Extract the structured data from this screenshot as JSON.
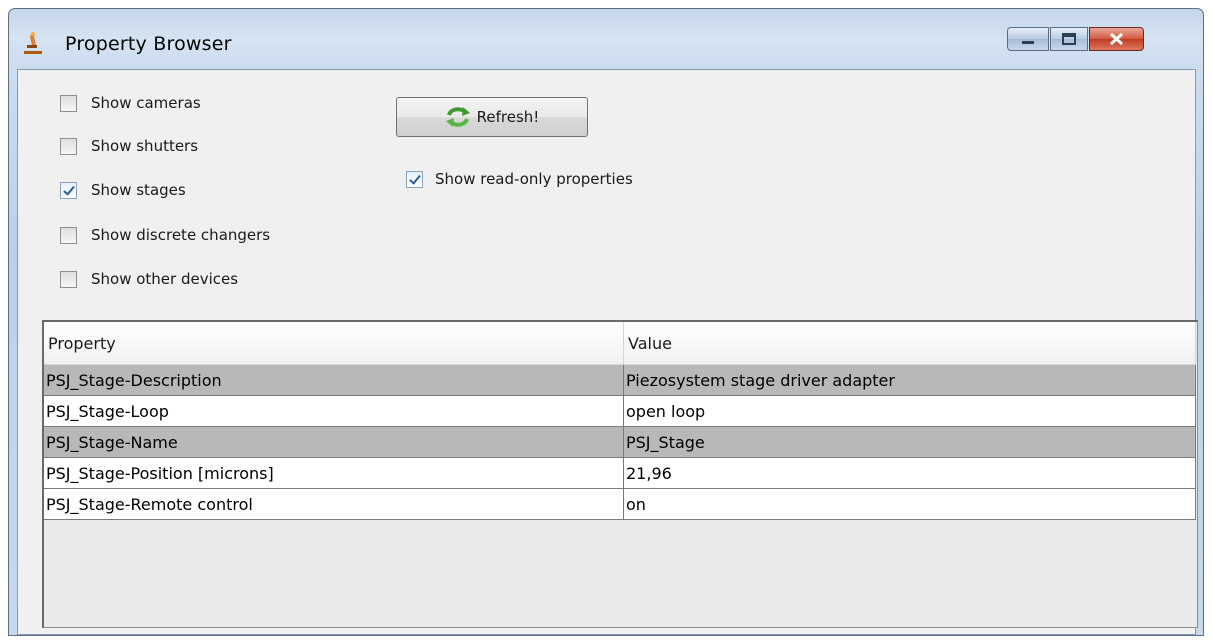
{
  "window": {
    "title": "Property Browser"
  },
  "filters": {
    "items": [
      {
        "label": "Show cameras",
        "checked": false
      },
      {
        "label": "Show shutters",
        "checked": false
      },
      {
        "label": "Show stages",
        "checked": true
      },
      {
        "label": "Show discrete changers",
        "checked": false
      },
      {
        "label": "Show other devices",
        "checked": false
      }
    ],
    "show_readonly": {
      "label": "Show read-only properties",
      "checked": true
    }
  },
  "toolbar": {
    "refresh_label": "Refresh!",
    "refresh_icon": "refresh-arrows-icon"
  },
  "table": {
    "columns": [
      "Property",
      "Value"
    ],
    "rows": [
      {
        "property": "PSJ_Stage-Description",
        "value": "Piezosystem stage driver adapter",
        "readonly": true
      },
      {
        "property": "PSJ_Stage-Loop",
        "value": "open loop",
        "readonly": false
      },
      {
        "property": "PSJ_Stage-Name",
        "value": "PSJ_Stage",
        "readonly": true
      },
      {
        "property": "PSJ_Stage-Position [microns]",
        "value": "21,96",
        "readonly": false
      },
      {
        "property": "PSJ_Stage-Remote control",
        "value": "on",
        "readonly": false
      }
    ]
  },
  "colors": {
    "readonly_row": "#b8b8b8",
    "editable_row": "#ffffff",
    "refresh_icon_green": "#3f9a2f"
  }
}
